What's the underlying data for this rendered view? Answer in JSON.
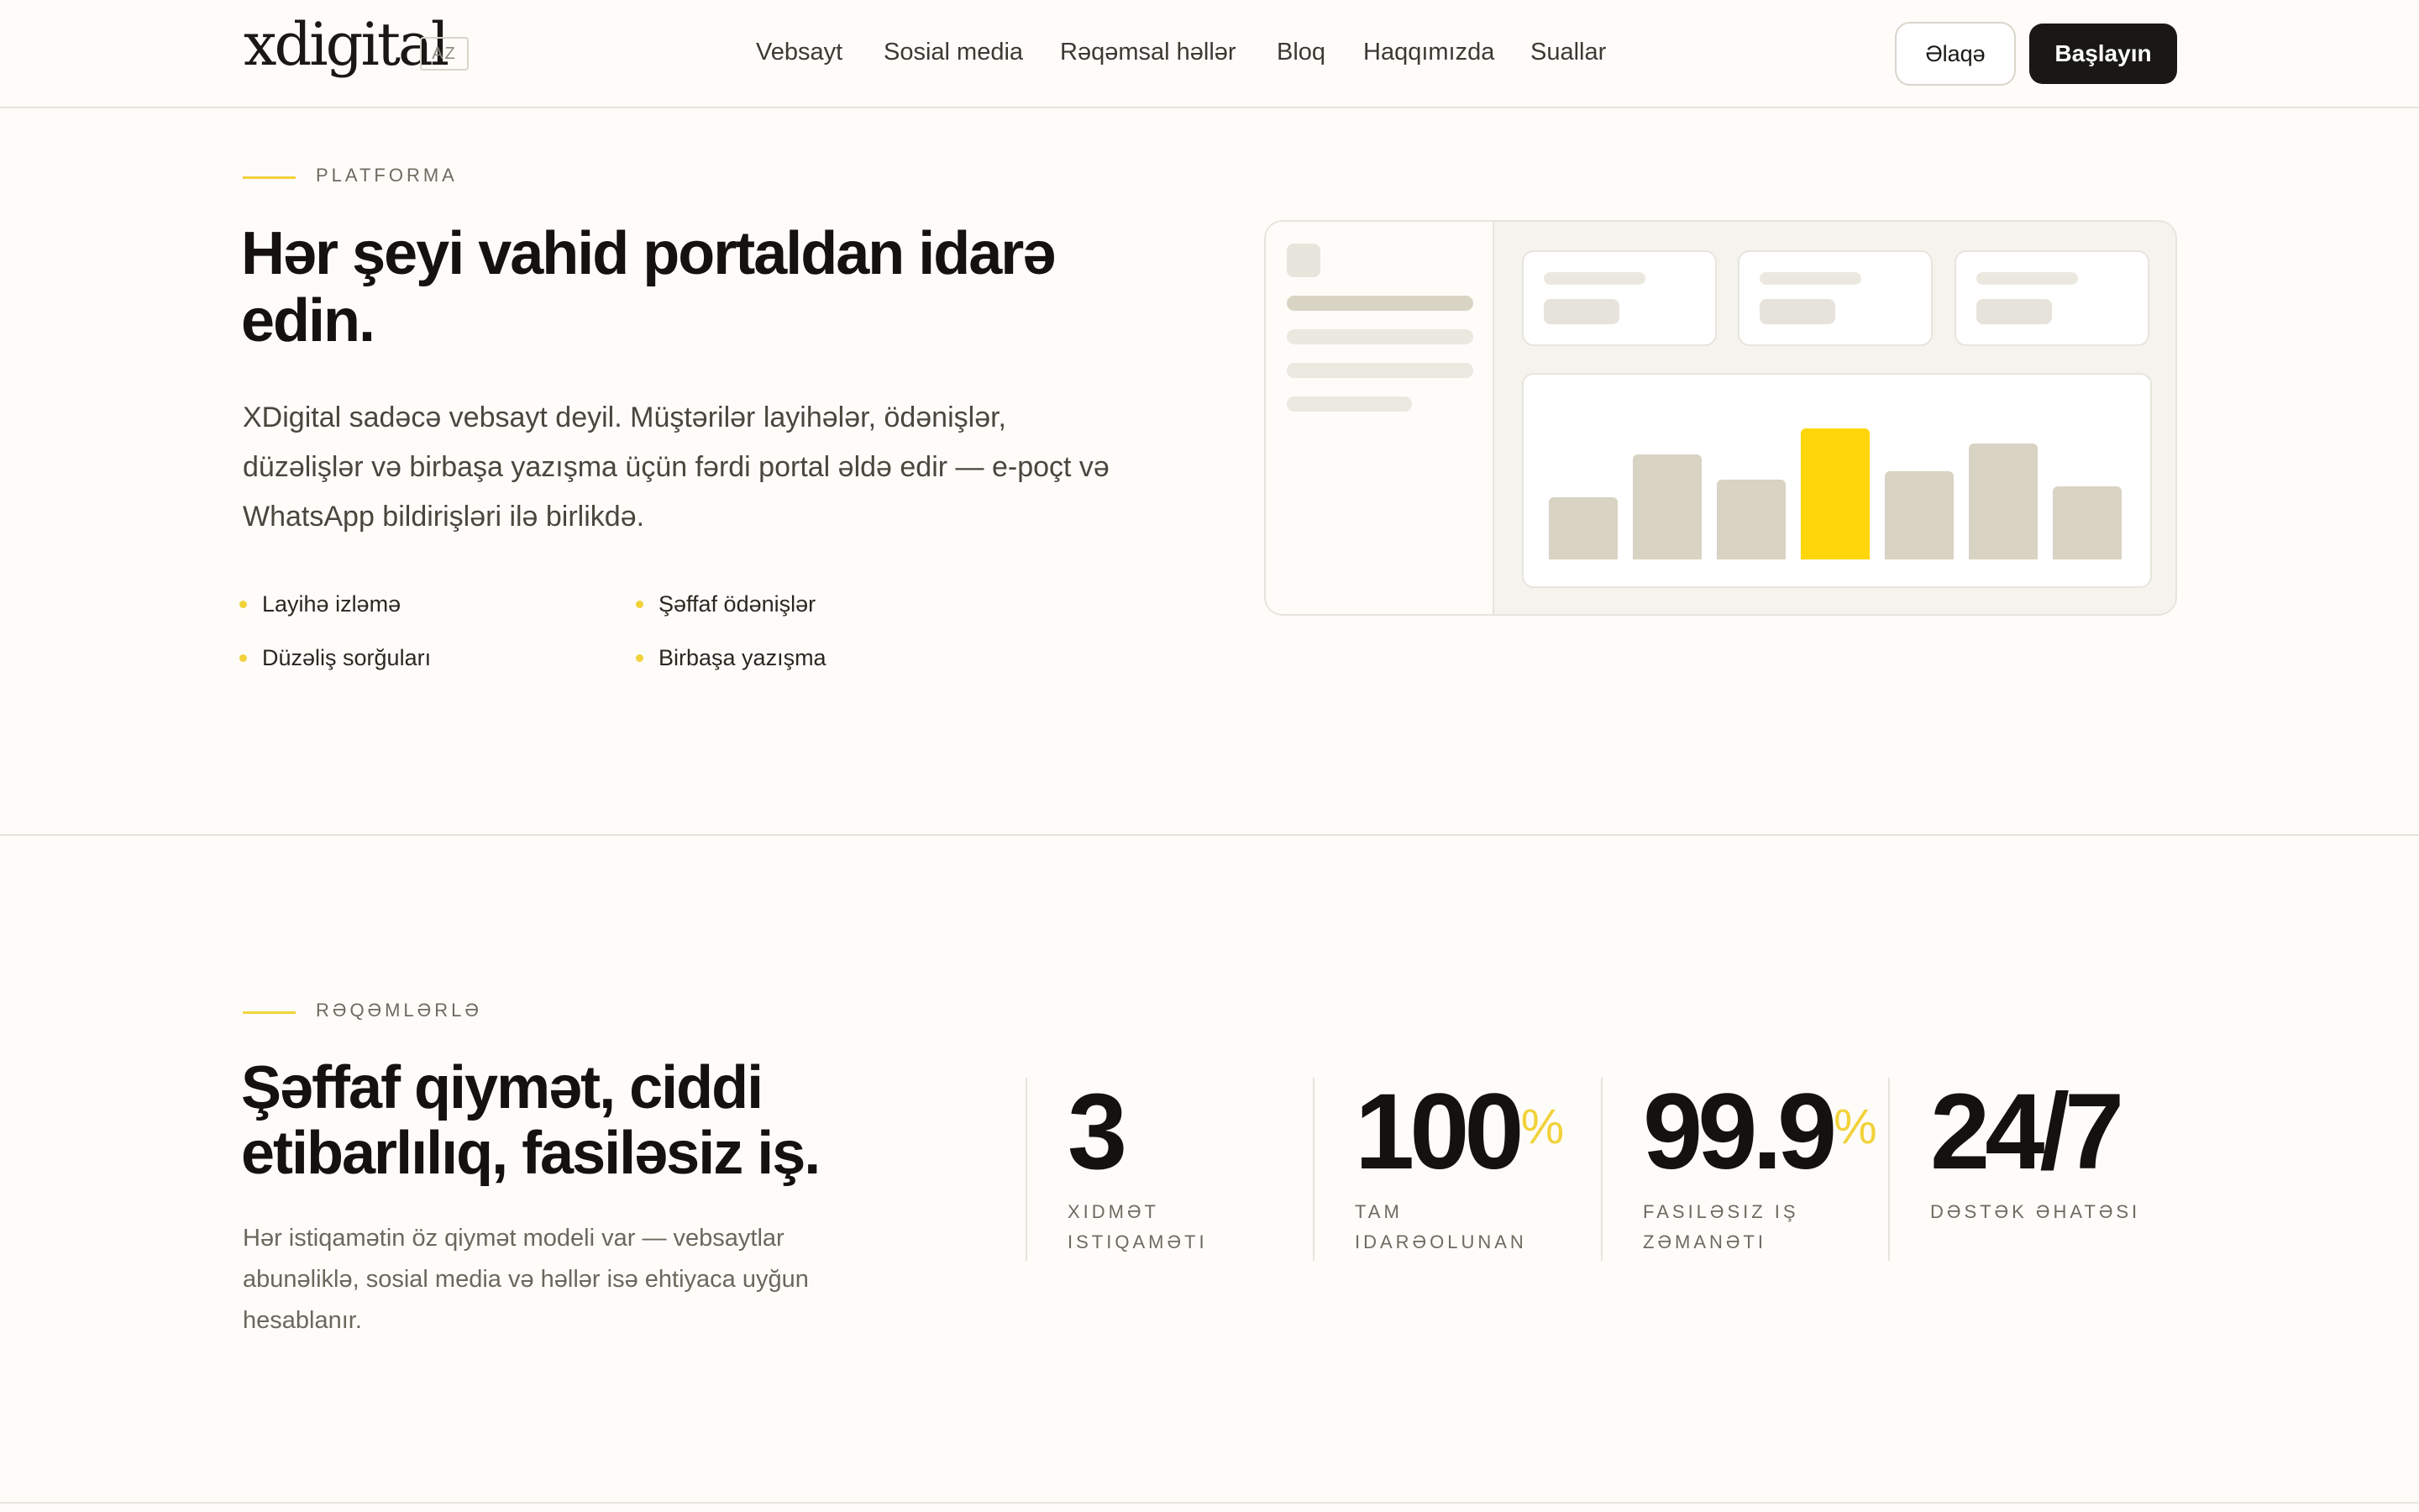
{
  "header": {
    "logo": "xdigital",
    "lang": "AZ",
    "nav": [
      "Vebsayt",
      "Sosial media",
      "Rəqəmsal həllər",
      "Bloq",
      "Haqqımızda",
      "Suallar"
    ],
    "contact_label": "Əlaqə",
    "start_label": "Başlayın"
  },
  "platform": {
    "eyebrow": "PLATFORMA",
    "title": "Hər şeyi vahid portaldan idarə edin.",
    "lead": "XDigital sadəcə vebsayt deyil. Müştərilər layihələr, ödənişlər, düzəlişlər və birbaşa yazışma üçün fərdi portal əldə edir — e-poçt və WhatsApp bildirişləri ilə birlikdə.",
    "features": [
      "Layihə izləmə",
      "Şəffaf ödənişlər",
      "Düzəliş sorğuları",
      "Birbaşa yazışma"
    ]
  },
  "mock_chart": {
    "values": [
      0.29,
      0.49,
      0.37,
      0.61,
      0.41,
      0.54,
      0.34
    ],
    "highlight_index": 3,
    "bar_color": "#d8d3c3",
    "highlight_color": "#ffd60a"
  },
  "numbers": {
    "eyebrow": "RƏQƏMLƏRLƏ",
    "title": "Şəffaf qiymət, ciddi etibarlılıq, fasiləsiz iş.",
    "subtitle": "Hər istiqamətin öz qiymət modeli var — vebsaytlar abunəliklə, sosial media və həllər isə ehtiyaca uyğun hesablanır.",
    "stats": [
      {
        "value": "3",
        "suffix": "",
        "caption": "Xidmət istiqaməti"
      },
      {
        "value": "100",
        "suffix": "%",
        "caption": "Tam idarəolunan"
      },
      {
        "value": "99.9",
        "suffix": "%",
        "caption": "Fasiləsiz iş zəmanəti"
      },
      {
        "value": "24/7",
        "suffix": "",
        "caption": "Dəstək əhatəsi"
      }
    ]
  },
  "colors": {
    "accent": "#f2d23a",
    "ink": "#14120e",
    "background": "#fdfcf9"
  }
}
